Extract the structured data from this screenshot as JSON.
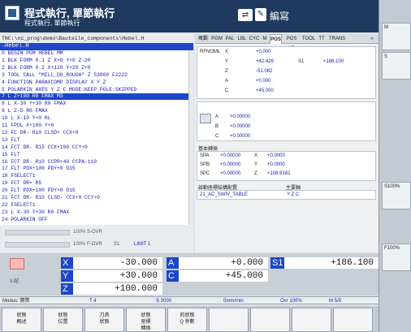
{
  "header": {
    "title": "程式執行, 單節執行",
    "subtitle": "程式執行, 單節執行",
    "edit_label": "編寫"
  },
  "program": {
    "path": "TNC:\\nc_prog\\demo\\Bauteile_components\\Hebel.H",
    "file_line": "→Hebel.H",
    "lines": [
      "0  BEGIN PGM HEBEL MM",
      "1  BLK FORM 0.1 Z X+0 Y+0 Z-20",
      "2  BLK FORM 0.2  X+120  Y+20  Z+0",
      "3  TOOL CALL \"MILL_D8_ROUGH\" Z S3000 F2222",
      "4  FUNCTION PARAXCOMP DISPLAY X Y Z",
      "5  POLARKIN AXES Y Z C MODE:KEEP POLE:SKIPPED",
      "7  L  Z+100 R0 FMAX M3",
      "8  L  X-30  Y+30 R0 FMAX",
      "9  L  Z-5 R0 FMAX",
      "10 L  X-10  Y+0 RL",
      "11 FPOL  X+100  Y+0",
      "12 FC DR- R10 CLSD+  CCX+0",
      "13 FLT",
      "14 FCT DR- R15  CCX+100  CCY+0",
      "15 FLT",
      "16 FCT DR- R10  CCPR+40  CCPA-110",
      "17 FLT PDX+100 PDY+0 D15",
      "18 FSELECT1",
      "19 FCT DR+ R5",
      "20 FLT PDX+100 PDY+0 D15",
      "21 FCT DR- R10 CLSD-  CCX+0  CCY+0",
      "22 FSELECT1",
      "23 L  X-30  Y+30 R0 FMAX",
      "24 POLARKIN OFF"
    ],
    "selected_index": 6,
    "override_s": "100% S-OVR",
    "override_f": "100% F-OVR",
    "override_s1": "S1",
    "override_limit": "LIMIT 1"
  },
  "status": {
    "tabs": [
      "概觀",
      "PGM",
      "PAL",
      "LBL",
      "CYC",
      "M",
      "POS",
      "POS HR",
      "TOOL",
      "TT",
      "TRANS"
    ],
    "active_tab": "POS",
    "rfnoml_label": "RFNOML",
    "rfnoml": [
      {
        "axis": "X",
        "value": "+0.000"
      },
      {
        "axis": "Y",
        "value": "+42.426"
      },
      {
        "axis": "Z",
        "value": "-51.082"
      },
      {
        "axis": "A",
        "value": "+0.000"
      },
      {
        "axis": "C",
        "value": "+45.000"
      }
    ],
    "s1_label": "S1",
    "s1_value": "+186.100",
    "rot": [
      {
        "axis": "A",
        "value": "+0.00000"
      },
      {
        "axis": "B",
        "value": "+0.00000"
      },
      {
        "axis": "C",
        "value": "+0.00000"
      }
    ],
    "basic_transform_title": "基本轉換",
    "transforms": [
      {
        "label": "SPA",
        "v1": "+0.00000",
        "ax": "X",
        "v2": "+0.0000"
      },
      {
        "label": "SPB",
        "v1": "+0.00000",
        "ax": "Y",
        "v2": "+0.0000"
      },
      {
        "label": "SPC",
        "v1": "+0.00000",
        "ax": "Z",
        "v2": "+108.9181"
      }
    ],
    "kin_label": "啟動座標結構配置",
    "main_axis_label": "主要軸",
    "kin_value": "21_AC_SWIV_TABLE",
    "main_axis_value": "Y Z C"
  },
  "position": {
    "rows": [
      [
        {
          "axis": "X",
          "value": "-30.000"
        },
        {
          "axis": "A",
          "value": "+0.000"
        },
        {
          "axis": "S1",
          "value": "+186.100"
        }
      ],
      [
        {
          "axis": "Y",
          "value": "+30.000"
        },
        {
          "axis": "C",
          "value": "+45.000"
        }
      ],
      [
        {
          "axis": "Z",
          "value": "+100.000"
        }
      ]
    ],
    "spindle_icon_label": "≡ 記"
  },
  "mode_line": {
    "modus": "Modus: 實際",
    "tool": "T 4",
    "s": "S 3000",
    "feed": "0mm/min",
    "ovr": "Ovr 100%",
    "m": "M 5/9"
  },
  "softkeys": [
    "狀態\n概述",
    "狀態\n位置",
    "刀具\n狀態",
    "狀態\n座標\n轉換",
    "的狀態\nQ 參數",
    "",
    "",
    "",
    ""
  ],
  "right_keys": [
    {
      "label": "M"
    },
    {
      "label": "S"
    },
    {
      "label": "S100%"
    },
    {
      "label": "F100%"
    }
  ],
  "colors": {
    "header_bg": "#1f3a5e",
    "selection": "#1d46c9",
    "program_text": "#1a1ab4"
  }
}
